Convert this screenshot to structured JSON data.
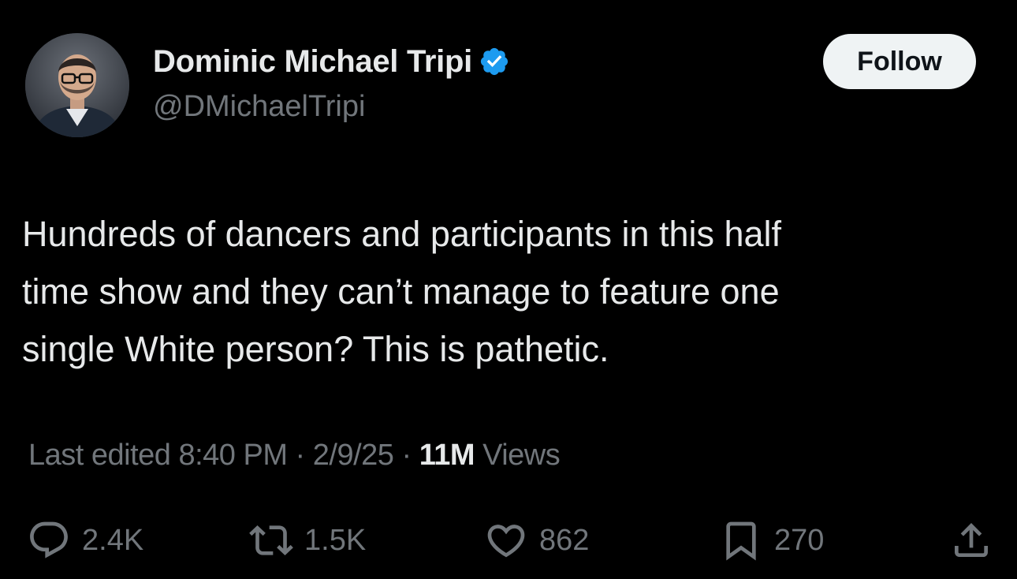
{
  "author": {
    "display_name": "Dominic Michael Tripi",
    "handle": "@DMichaelTripi",
    "verified": true
  },
  "follow_button": {
    "label": "Follow"
  },
  "tweet": {
    "lines": [
      "Hundreds of dancers and participants in this half",
      "time show and they can’t manage to feature one",
      "single White person? This is pathetic."
    ]
  },
  "meta": {
    "edited_label": "Last edited 8:40 PM · 2/9/25 · ",
    "views_count": "11M",
    "views_label": " Views"
  },
  "actions": {
    "replies": "2.4K",
    "reposts": "1.5K",
    "likes": "862",
    "bookmarks": "270"
  },
  "colors": {
    "background": "#000000",
    "primary_text": "#e7e9ea",
    "secondary_text": "#71767b",
    "verified_badge": "#1d9bf0",
    "follow_button_bg": "#eff3f4"
  },
  "icons": {
    "reply": "reply-icon",
    "repost": "repost-icon",
    "like": "heart-icon",
    "bookmark": "bookmark-icon",
    "share": "share-icon",
    "verified": "verified-badge-icon"
  }
}
